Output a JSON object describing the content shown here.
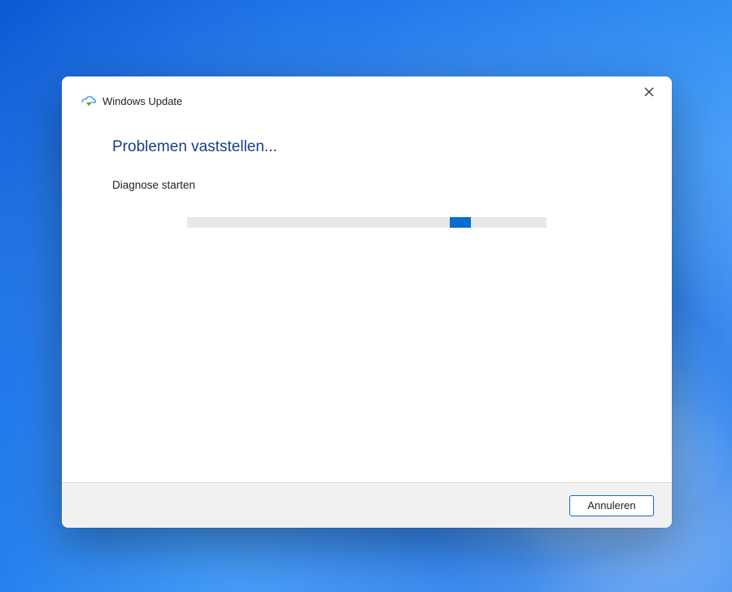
{
  "dialog": {
    "title": "Windows Update",
    "heading": "Problemen vaststellen...",
    "subheading": "Diagnose starten",
    "progress": {
      "indeterminate": true,
      "indicator_position_pct": 73
    },
    "cancel_label": "Annuleren"
  },
  "colors": {
    "accent": "#0a6cce",
    "heading": "#1a3e8c",
    "footer_bg": "#f1f1f1",
    "progress_track": "#e8e8e8"
  }
}
